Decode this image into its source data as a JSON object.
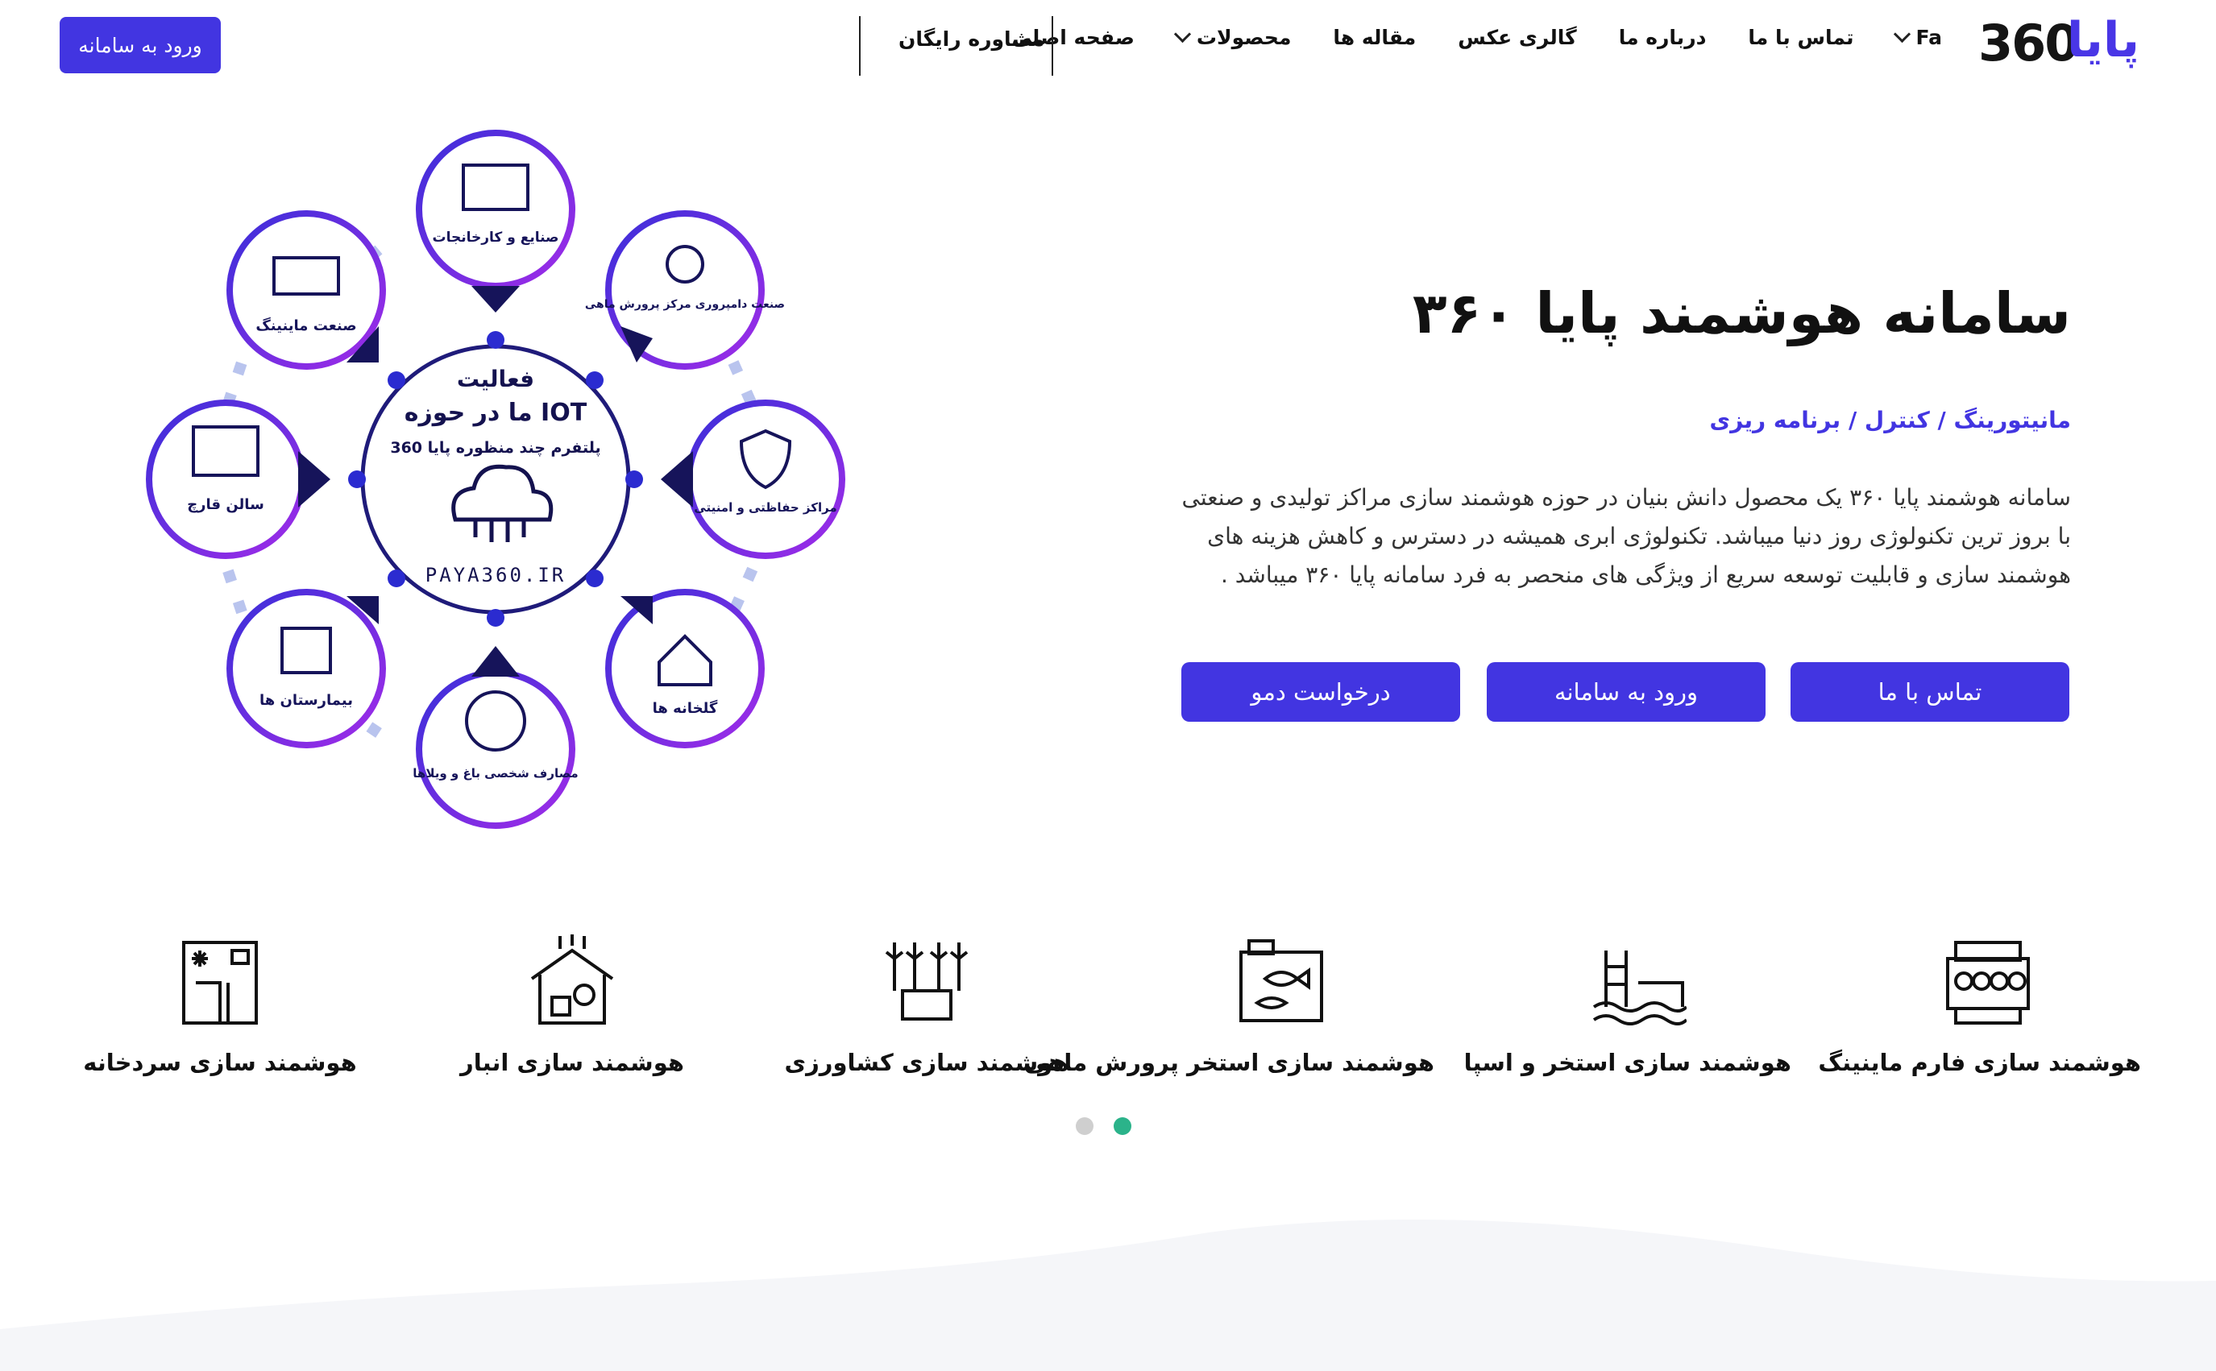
{
  "nav": {
    "logo_number": "360",
    "logo_text": "پایا",
    "items": [
      "صفحه اصلی",
      "محصولات",
      "مقاله ها",
      "گالری عکس",
      "درباره ما",
      "تماس با ما"
    ],
    "language": "Fa",
    "consult": "مشاوره رایگان",
    "login": "ورود به سامانه"
  },
  "hero": {
    "title": "سامانه هوشمند پایا ۳۶۰",
    "subtitle": "مانیتورینگ / کنترل / برنامه ریزی",
    "description": "سامانه هوشمند پایا ۳۶۰ یک محصول دانش بنیان در حوزه هوشمند سازی مراکز تولیدی و صنعتی با بروز ترین تکنولوژی روز دنیا میباشد. تکنولوژی ابری همیشه در دسترس و کاهش هزینه های هوشمند سازی و قابلیت توسعه سریع از ویژگی های منحصر به فرد سامانه پایا ۳۶۰ میباشد .",
    "buttons": [
      "تماس با ما",
      "ورود به سامانه",
      "درخواست دمو"
    ]
  },
  "diagram": {
    "center_title_1": "فعالیت",
    "center_title_2": "ما در حوزه IOT",
    "center_title_3": "پلتفرم چند منظوره پایا 360",
    "center_url": "PAYA360.IR",
    "nodes": [
      "صنایع و کارخانجات",
      "صنعت دامپروری مرکز پرورش ماهی",
      "مراکز حفاظتی و امنیتی",
      "گلخانه ها",
      "مصارف شخصی باغ و ویلاها",
      "بیمارستان ها",
      "سالن قارچ",
      "صنعت ماینینگ"
    ]
  },
  "features": [
    {
      "label": "هوشمند سازی فارم ماینینگ",
      "icon": "mining-farm-icon"
    },
    {
      "label": "هوشمند سازی استخر و اسپا",
      "icon": "pool-icon"
    },
    {
      "label": "هوشمند سازی استخر پرورش ماهی",
      "icon": "fish-farm-icon"
    },
    {
      "label": "هوشمند سازی کشاورزی",
      "icon": "agriculture-icon"
    },
    {
      "label": "هوشمند سازی انبار",
      "icon": "warehouse-icon"
    },
    {
      "label": "هوشمند سازی سردخانه",
      "icon": "cold-storage-icon"
    }
  ],
  "colors": {
    "accent": "#4235e1",
    "dot_active": "#2bb38a",
    "dot_inactive": "#cfcfcf",
    "ring": "#6b2fe3"
  }
}
